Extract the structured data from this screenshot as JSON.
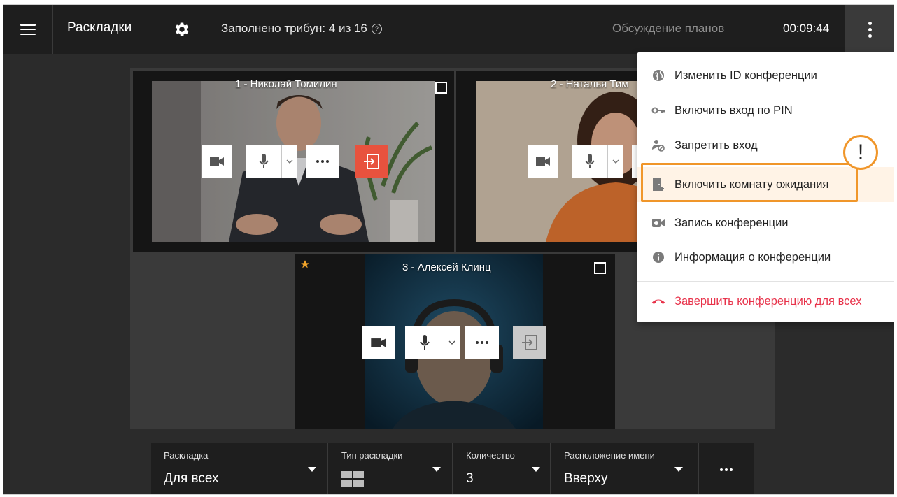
{
  "topbar": {
    "title": "Раскладки",
    "tribunes": "Заполнено трибун: 4 из 16",
    "conference_name": "Обсуждение планов",
    "timer": "00:09:44"
  },
  "tiles": [
    {
      "label": "1 - Николай Томилин"
    },
    {
      "label": "2 - Наталья Тим"
    },
    {
      "label": "3 - Алексей Клинц"
    }
  ],
  "menu": {
    "items": [
      {
        "label": "Изменить ID конференции",
        "icon": "globe-icon"
      },
      {
        "label": "Включить вход по PIN",
        "icon": "key-icon"
      },
      {
        "label": "Запретить вход",
        "icon": "user-block-icon"
      },
      {
        "label": "Включить комнату ожидания",
        "icon": "waiting-room-icon"
      },
      {
        "label": "Запись конференции",
        "icon": "record-icon"
      },
      {
        "label": "Информация о конференции",
        "icon": "info-icon"
      },
      {
        "label": "Завершить конференцию для всех",
        "icon": "hangup-icon"
      }
    ]
  },
  "callout": {
    "mark": "!"
  },
  "bottombar": {
    "layout": {
      "label": "Раскладка",
      "value": "Для всех"
    },
    "layout_type": {
      "label": "Тип раскладки"
    },
    "count": {
      "label": "Количество",
      "value": "3"
    },
    "name_position": {
      "label": "Расположение имени",
      "value": "Вверху"
    }
  },
  "colors": {
    "accent_orange": "#f0962a",
    "danger_red": "#e8324a",
    "exit_button_red": "#e8523e",
    "topbar_bg": "#1e1e1e",
    "stage_bg": "#3a3a3a"
  }
}
